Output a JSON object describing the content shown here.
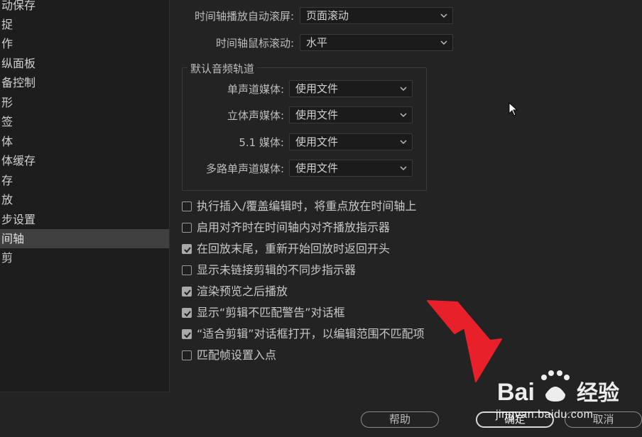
{
  "sidebar": {
    "items": [
      {
        "label": "动保存"
      },
      {
        "label": "捉"
      },
      {
        "label": "作"
      },
      {
        "label": "纵面板"
      },
      {
        "label": "备控制"
      },
      {
        "label": "形"
      },
      {
        "label": "签"
      },
      {
        "label": "体"
      },
      {
        "label": "体缓存"
      },
      {
        "label": "存"
      },
      {
        "label": "放"
      },
      {
        "label": "步设置"
      },
      {
        "label": "间轴",
        "selected": true
      },
      {
        "label": "剪"
      }
    ]
  },
  "settings": {
    "autoscroll": {
      "label": "时间轴播放自动滚屏:",
      "value": "页面滚动"
    },
    "mousescroll": {
      "label": "时间轴鼠标滚动:",
      "value": "水平"
    }
  },
  "audio_group": {
    "title": "默认音频轨道",
    "rows": [
      {
        "label": "单声道媒体:",
        "value": "使用文件"
      },
      {
        "label": "立体声媒体:",
        "value": "使用文件"
      },
      {
        "label": "5.1 媒体:",
        "value": "使用文件"
      },
      {
        "label": "多路单声道媒体:",
        "value": "使用文件"
      }
    ]
  },
  "checkboxes": [
    {
      "label": "执行插入/覆盖编辑时，将重点放在时间轴上",
      "checked": false
    },
    {
      "label": "启用对齐时在时间轴内对齐播放指示器",
      "checked": false
    },
    {
      "label": "在回放末尾，重新开始回放时返回开头",
      "checked": true
    },
    {
      "label": "显示未链接剪辑的不同步指示器",
      "checked": false
    },
    {
      "label": "渲染预览之后播放",
      "checked": true
    },
    {
      "label": "显示“剪辑不匹配警告”对话框",
      "checked": true
    },
    {
      "label": "“适合剪辑”对话框打开，以编辑范围不匹配项",
      "checked": true
    },
    {
      "label": "匹配帧设置入点",
      "checked": false
    }
  ],
  "buttons": {
    "help": "帮助",
    "ok": "确定",
    "cancel": "取消"
  },
  "watermark": {
    "brand": "Baidu经验",
    "url": "jingyan.baidu.com"
  },
  "colors": {
    "annotation_arrow": "#e8202a"
  }
}
